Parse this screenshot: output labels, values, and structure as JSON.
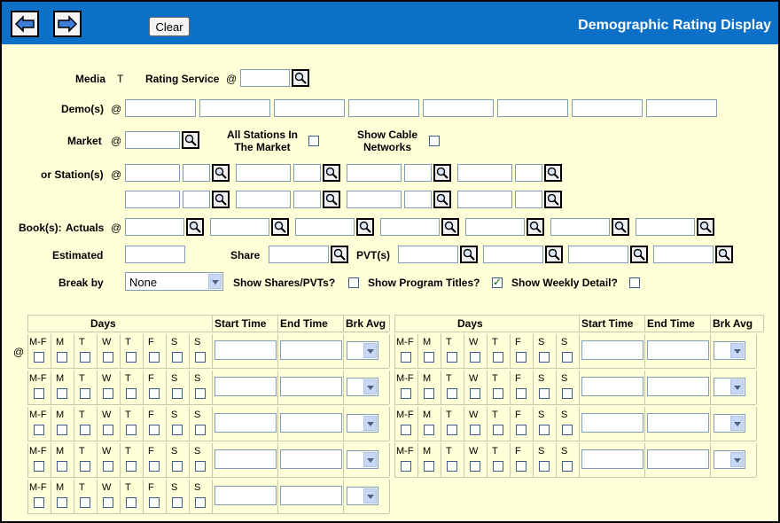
{
  "header": {
    "title": "Demographic Rating Display",
    "clear_label": "Clear"
  },
  "form": {
    "media_label": "Media",
    "media_value": "T",
    "rating_service_label": "Rating Service",
    "at": "@",
    "demos_label": "Demo(s)",
    "market_label": "Market",
    "all_stations_label_1": "All Stations In",
    "all_stations_label_2": "The Market",
    "show_cable_label_1": "Show Cable",
    "show_cable_label_2": "Networks",
    "stations_label": "or Station(s)",
    "books_label": "Book(s):",
    "actuals_label": "Actuals",
    "estimated_label": "Estimated",
    "share_label": "Share",
    "pvts_label": "PVT(s)",
    "break_by_label": "Break by",
    "break_by_value": "None",
    "show_shares_label": "Show Shares/PVTs?",
    "show_program_titles_label": "Show Program Titles?",
    "show_weekly_detail_label": "Show Weekly Detail?"
  },
  "grid": {
    "days_header": "Days",
    "start_time_header": "Start Time",
    "end_time_header": "End Time",
    "brk_avg_header": "Brk Avg",
    "row_marker": "@",
    "day_labels": [
      "M-F",
      "M",
      "T",
      "W",
      "T",
      "F",
      "S",
      "S"
    ]
  },
  "colors": {
    "header_blue": "#0c70c8",
    "panel_bg": "#ffffd8"
  }
}
